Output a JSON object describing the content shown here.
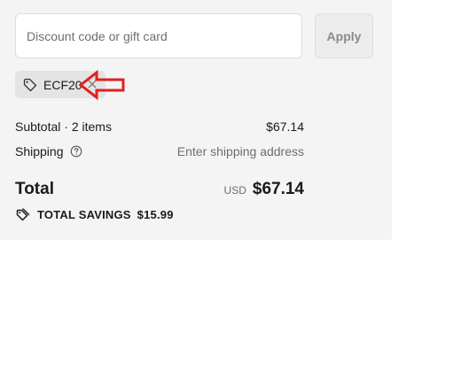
{
  "discount": {
    "placeholder": "Discount code or gift card",
    "value": "",
    "apply_label": "Apply"
  },
  "applied_code": {
    "code": "ECF20",
    "icon": "tag-icon",
    "remove_icon": "close-icon"
  },
  "annotation": {
    "icon": "red-arrow-left-icon",
    "color": "#e02020"
  },
  "summary": {
    "subtotal_label": "Subtotal · 2 items",
    "subtotal_value": "$67.14",
    "shipping_label": "Shipping",
    "shipping_help_icon": "help-circle-icon",
    "shipping_value": "Enter shipping address",
    "total_label": "Total",
    "currency": "USD",
    "total_value": "$67.14",
    "savings_icon": "tags-icon",
    "savings_label": "TOTAL SAVINGS",
    "savings_value": "$15.99"
  },
  "colors": {
    "panel_background": "#f4f4f4",
    "chip_background": "#e4e4e4",
    "muted_text": "#6e6e6e"
  }
}
